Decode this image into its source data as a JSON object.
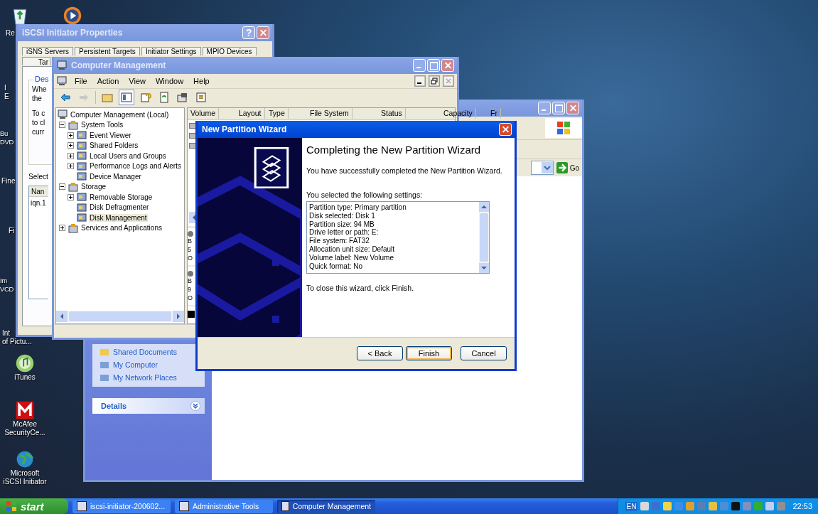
{
  "desktop": {
    "icons": [
      {
        "kind": "recycle",
        "lines": [
          "Re"
        ]
      },
      {
        "kind": "player"
      },
      {
        "kind": "hidden",
        "lines": [
          "I",
          "E"
        ]
      },
      {
        "kind": "hidden",
        "lines": [
          "Bu",
          "DVD"
        ]
      },
      {
        "kind": "hidden",
        "lines": [
          "Fine"
        ]
      },
      {
        "kind": "hidden",
        "lines": [
          "Fi"
        ]
      },
      {
        "kind": "hidden",
        "lines": [
          "Im",
          "VCD"
        ]
      },
      {
        "kind": "hidden",
        "lines": [
          "Int",
          "of Pictu..."
        ]
      },
      {
        "kind": "itunes",
        "lines": [
          "iTunes"
        ]
      },
      {
        "kind": "mcafee",
        "lines": [
          "McAfee",
          "SecurityCe..."
        ]
      },
      {
        "kind": "globe",
        "lines": [
          "Microsoft",
          "iSCSI Initiator"
        ]
      }
    ]
  },
  "explorer_window": {
    "go": "Go",
    "tasks": [
      "Shared Documents",
      "My Computer",
      "My Network Places"
    ],
    "details": "Details"
  },
  "iscsi_window": {
    "title": "iSCSI Initiator Properties",
    "help": "?",
    "tabs": [
      "iSNS Servers",
      "Persistent Targets",
      "Initiator Settings",
      "MPIO Devices"
    ],
    "tab_row_2": "Tar",
    "group_label": "Des",
    "fragments": [
      "Whe",
      "the",
      "To c",
      "to cl",
      "curr"
    ],
    "select_label": "Select",
    "column": "Nan",
    "cell": "iqn.1"
  },
  "computer_management": {
    "title": "Computer Management",
    "menu": [
      "File",
      "Action",
      "View",
      "Window",
      "Help"
    ],
    "tree": [
      {
        "label": "Computer Management (Local)",
        "children": [
          {
            "label": "System Tools",
            "expanded": true,
            "children": [
              {
                "label": "Event Viewer",
                "expanded": false,
                "selected": false
              },
              {
                "label": "Shared Folders",
                "expanded": false,
                "selected": false
              },
              {
                "label": "Local Users and Groups",
                "expanded": false,
                "selected": false
              },
              {
                "label": "Performance Logs and Alerts",
                "expanded": false,
                "selected": false
              },
              {
                "label": "Device Manager",
                "selected": false
              }
            ]
          },
          {
            "label": "Storage",
            "expanded": true,
            "children": [
              {
                "label": "Removable Storage",
                "expanded": false,
                "selected": false
              },
              {
                "label": "Disk Defragmenter",
                "selected": false
              },
              {
                "label": "Disk Management",
                "selected": true
              }
            ]
          },
          {
            "label": "Services and Applications",
            "expanded": false
          }
        ]
      }
    ],
    "columns": [
      "Volume",
      "Layout",
      "Type",
      "File System",
      "Status",
      "Capacity",
      "Fr"
    ],
    "disks": [
      [
        "B",
        "5",
        "O"
      ],
      [
        "B",
        "9",
        "O"
      ]
    ]
  },
  "wizard": {
    "title": "New Partition Wizard",
    "heading": "Completing the New Partition Wizard",
    "intro": "You have successfully completed the New Partition Wizard.",
    "settings_label": "You selected the following settings:",
    "settings": [
      "Partition type: Primary partition",
      "Disk selected: Disk 1",
      "Partition size: 94 MB",
      "Drive letter or path: E:",
      "File system: FAT32",
      "Allocation unit size: Default",
      "Volume label: New Volume",
      "Quick format: No"
    ],
    "closing": "To close this wizard, click Finish.",
    "buttons": [
      {
        "label": "< Back",
        "default": false
      },
      {
        "label": "Finish",
        "default": true
      },
      {
        "label": "Cancel",
        "default": false
      }
    ]
  },
  "taskbar": {
    "start": "start",
    "tasks": [
      {
        "label": "iscsi-initiator-200602...",
        "selected": false
      },
      {
        "label": "Administrative Tools",
        "selected": false
      },
      {
        "label": "Computer Management",
        "selected": true
      }
    ],
    "language": "EN",
    "clock": "22:53"
  }
}
